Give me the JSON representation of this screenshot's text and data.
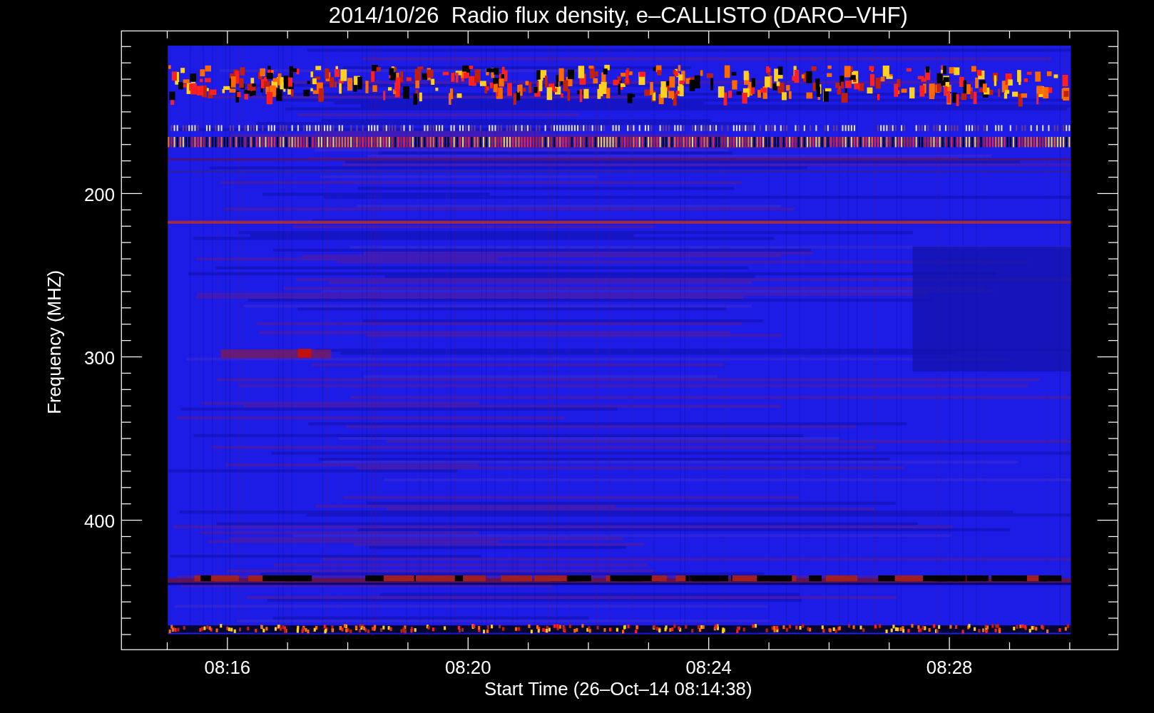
{
  "title": "2014/10/26  Radio flux density, e–CALLISTO (DARO–VHF)",
  "plot": {
    "ylabel": "Frequency (MHZ)",
    "xlabel": "Start Time (26–Oct–14 08:14:38)",
    "yticks": [
      "200",
      "300",
      "400"
    ],
    "xticks": [
      "08:16",
      "08:20",
      "08:24",
      "08:28"
    ]
  }
}
